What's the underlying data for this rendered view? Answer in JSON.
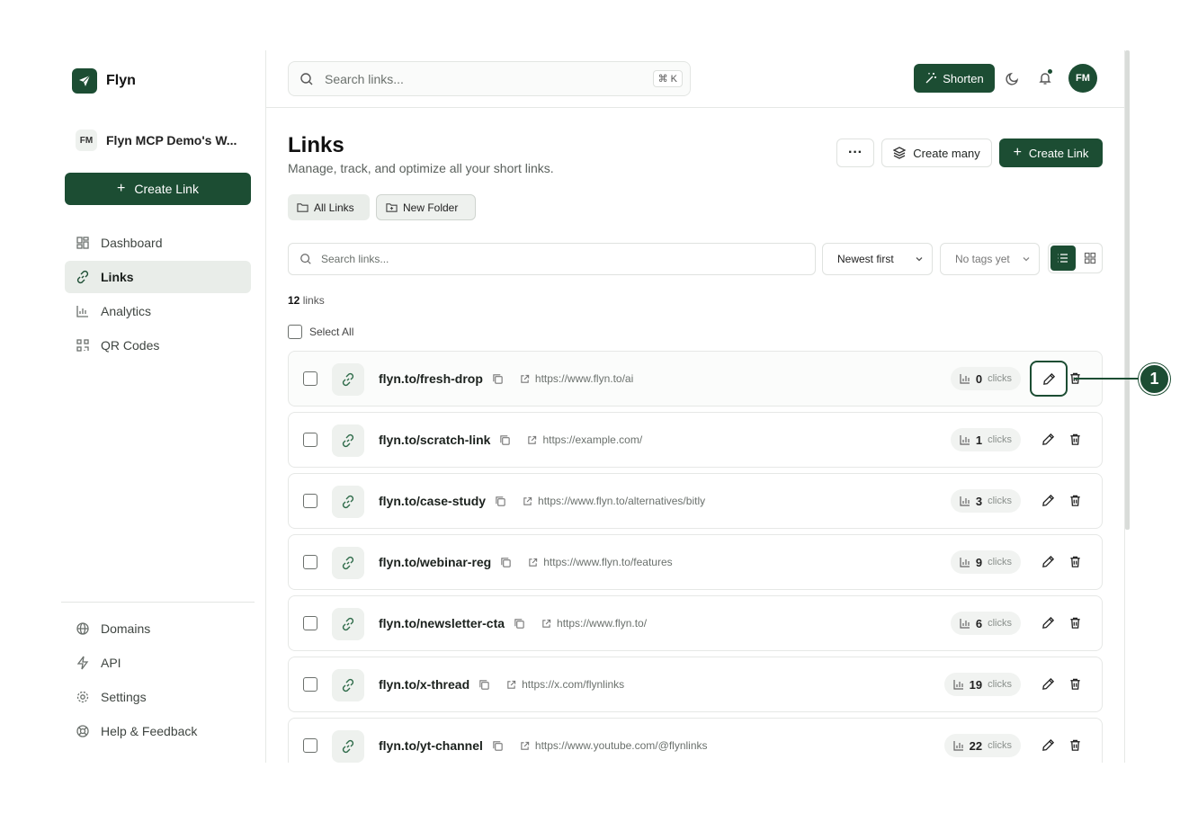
{
  "brand": {
    "name": "Flyn"
  },
  "workspace": {
    "initials": "FM",
    "name": "Flyn MCP Demo's W..."
  },
  "sidebar": {
    "create_label": "Create Link",
    "items": [
      {
        "label": "Dashboard",
        "icon": "dashboard-icon"
      },
      {
        "label": "Links",
        "icon": "link-icon",
        "active": true
      },
      {
        "label": "Analytics",
        "icon": "analytics-icon"
      },
      {
        "label": "QR Codes",
        "icon": "qr-code-icon"
      }
    ],
    "bottom_items": [
      {
        "label": "Domains",
        "icon": "globe-icon"
      },
      {
        "label": "API",
        "icon": "bolt-icon"
      },
      {
        "label": "Settings",
        "icon": "gear-icon"
      },
      {
        "label": "Help & Feedback",
        "icon": "lifebuoy-icon"
      }
    ]
  },
  "topbar": {
    "search_placeholder": "Search links...",
    "shortcut": "⌘ K",
    "shorten_label": "Shorten",
    "user_initials": "FM"
  },
  "page": {
    "title": "Links",
    "subtitle": "Manage, track, and optimize all your short links.",
    "more_label": "···",
    "create_many_label": "Create many",
    "create_link_label": "Create Link"
  },
  "folders": {
    "all_label": "All Links",
    "new_label": "New Folder"
  },
  "filters": {
    "search_placeholder": "Search links...",
    "sort_value": "Newest first",
    "tags_value": "No tags yet"
  },
  "count": {
    "number": "12",
    "label": "links"
  },
  "select_all_label": "Select All",
  "links": [
    {
      "short": "flyn.to/fresh-drop",
      "url": "https://www.flyn.to/ai",
      "clicks": "0"
    },
    {
      "short": "flyn.to/scratch-link",
      "url": "https://example.com/",
      "clicks": "1"
    },
    {
      "short": "flyn.to/case-study",
      "url": "https://www.flyn.to/alternatives/bitly",
      "clicks": "3"
    },
    {
      "short": "flyn.to/webinar-reg",
      "url": "https://www.flyn.to/features",
      "clicks": "9"
    },
    {
      "short": "flyn.to/newsletter-cta",
      "url": "https://www.flyn.to/",
      "clicks": "6"
    },
    {
      "short": "flyn.to/x-thread",
      "url": "https://x.com/flynlinks",
      "clicks": "19"
    },
    {
      "short": "flyn.to/yt-channel",
      "url": "https://www.youtube.com/@flynlinks",
      "clicks": "22"
    }
  ],
  "clicks_label": "clicks",
  "callout": {
    "number": "1"
  },
  "colors": {
    "accent": "#1c4d33",
    "border": "#e6e8e6",
    "muted": "#6b716d"
  }
}
